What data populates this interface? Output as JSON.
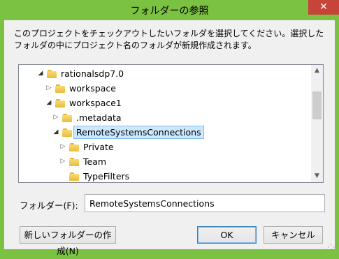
{
  "window": {
    "title": "フォルダーの参照",
    "close_glyph": "✕"
  },
  "description": "このプロジェクトをチェックアウトしたいフォルダを選択してください。選択したフォルダの中にプロジェクト名のフォルダが新規作成されます。",
  "tree": {
    "items": [
      {
        "label": "rationalsdp7.0",
        "expander": "open"
      },
      {
        "label": "workspace",
        "expander": "closed"
      },
      {
        "label": "workspace1",
        "expander": "open"
      },
      {
        "label": ".metadata",
        "expander": "closed"
      },
      {
        "label": "RemoteSystemsConnections",
        "expander": "open",
        "selected": true
      },
      {
        "label": "Private",
        "expander": "closed"
      },
      {
        "label": "Team",
        "expander": "closed"
      },
      {
        "label": "TypeFilters",
        "expander": "none"
      }
    ]
  },
  "folder_field": {
    "label": "フォルダー(F):",
    "value": "RemoteSystemsConnections"
  },
  "buttons": {
    "new_folder": "新しいフォルダーの作成(N)",
    "ok": "OK",
    "cancel": "キャンセル"
  },
  "colors": {
    "frame": "#7bc142",
    "close": "#c7443a",
    "selection": "#cce8ff"
  }
}
